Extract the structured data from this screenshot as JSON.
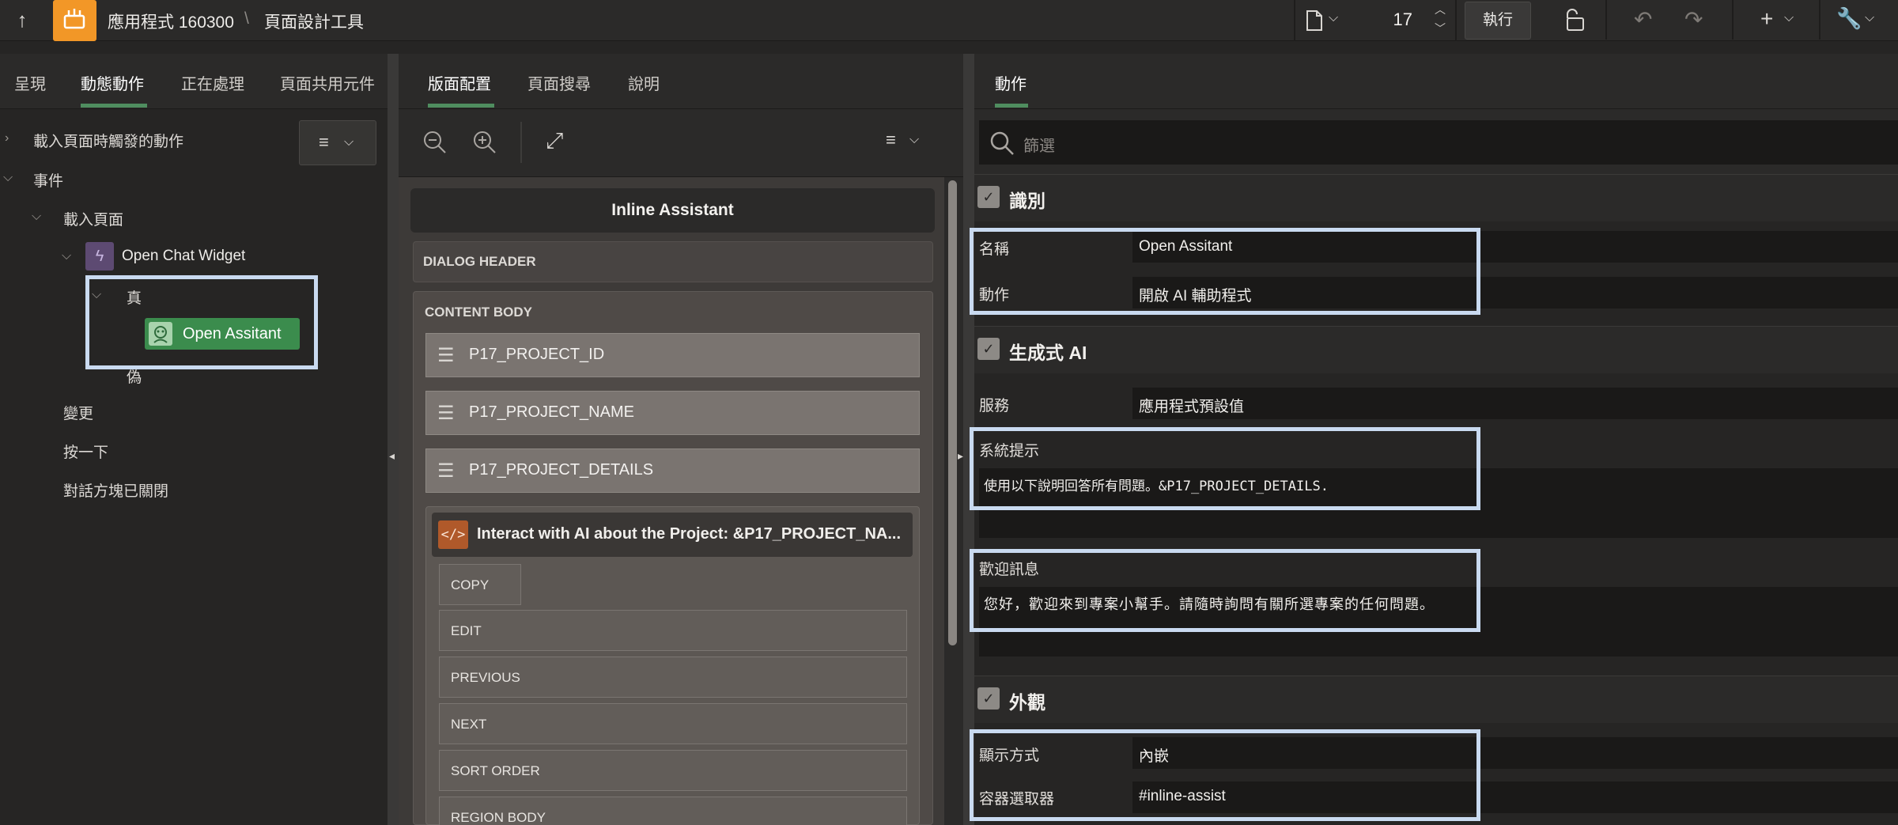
{
  "topbar": {
    "app_name": "應用程式 160300",
    "breadcrumb_sep": "\\",
    "tool_name": "頁面設計工具",
    "page_number": "17",
    "run_label": "執行"
  },
  "left_panel": {
    "tabs": [
      "呈現",
      "動態動作",
      "正在處理",
      "頁面共用元件"
    ],
    "tree": {
      "on_load": "載入頁面時觸發的動作",
      "events": "事件",
      "page_load": "載入頁面",
      "dynamic_action": "Open Chat Widget",
      "true_branch": "真",
      "action": "Open Assitant",
      "false_branch": "偽",
      "change": "變更",
      "click": "按一下",
      "dialog_closed": "對話方塊已關閉"
    }
  },
  "middle_panel": {
    "tabs": [
      "版面配置",
      "頁面搜尋",
      "說明"
    ],
    "region_title": "Inline Assistant",
    "dialog_header": "DIALOG HEADER",
    "content_body": "CONTENT BODY",
    "items": [
      "P17_PROJECT_ID",
      "P17_PROJECT_NAME",
      "P17_PROJECT_DETAILS"
    ],
    "sub_region": "Interact with AI about the Project: &P17_PROJECT_NA...",
    "slots": [
      "COPY",
      "EDIT",
      "PREVIOUS",
      "NEXT",
      "SORT ORDER",
      "REGION BODY"
    ]
  },
  "right_panel": {
    "tab": "動作",
    "filter_placeholder": "篩選",
    "sections": {
      "identification": "識別",
      "gen_ai": "生成式 AI",
      "appearance": "外觀"
    },
    "fields": {
      "name_label": "名稱",
      "name_value": "Open Assitant",
      "action_label": "動作",
      "action_value": "開啟 AI 輔助程式",
      "service_label": "服務",
      "service_value": "應用程式預設值",
      "system_prompt_label": "系統提示",
      "system_prompt_value": "使用以下說明回答所有問題。&P17_PROJECT_DETAILS.",
      "welcome_label": "歡迎訊息",
      "welcome_value": "您好，歡迎來到專案小幫手。請隨時詢問有關所選專案的任何問題。",
      "display_label": "顯示方式",
      "display_value": "內嵌",
      "container_label": "容器選取器",
      "container_value": "#inline-assist"
    }
  },
  "colors": {
    "accent_orange": "#f29727",
    "accent_green": "#4f8d5f",
    "highlight": "#c9daf0",
    "da_purple": "#5d4a72",
    "code_orange": "#b0592a"
  }
}
